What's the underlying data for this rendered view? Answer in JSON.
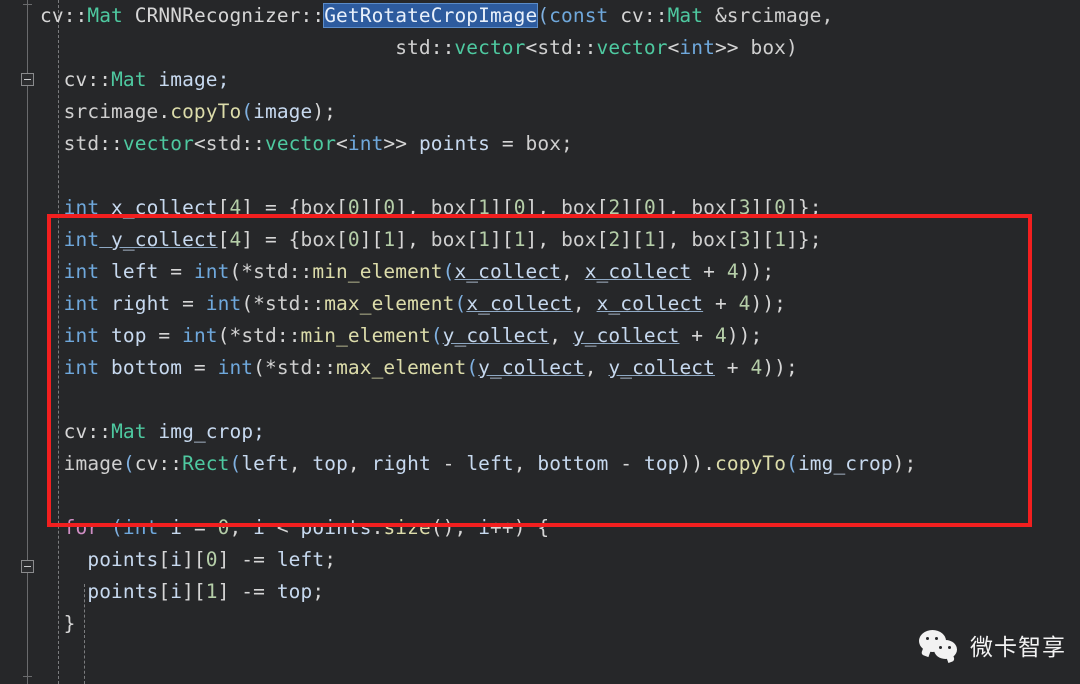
{
  "editor": {
    "theme_background": "#262729",
    "foreground": "#d6d6d6",
    "language": "C++",
    "font_size_px": 19.5,
    "line_height_px": 32,
    "gutter": {
      "fold_markers": [
        {
          "name": "fold-marker-function-body",
          "state": "expanded",
          "glyph": "minus-box"
        },
        {
          "name": "fold-marker-for-loop",
          "state": "expanded",
          "glyph": "minus-box"
        }
      ]
    },
    "selection": {
      "text": "GetRotateCropImage",
      "background": "#2d5b9e",
      "foreground": "#e8f0fb"
    },
    "annotation": {
      "shape": "rectangle",
      "color": "#f21f1f",
      "border_px": 4,
      "encloses_lines": [
        6,
        7,
        8,
        9,
        10,
        11,
        12,
        13,
        14
      ]
    }
  },
  "code": {
    "lines": [
      {
        "n": 1,
        "tokens": [
          {
            "t": "cv",
            "c": "plain"
          },
          {
            "t": "::",
            "c": "punc"
          },
          {
            "t": "Mat",
            "c": "cls"
          },
          {
            "t": " CRNNRecognizer",
            "c": "plain"
          },
          {
            "t": "::",
            "c": "punc"
          },
          {
            "t": "GetRotateCropImage",
            "c": "sel"
          },
          {
            "t": "(",
            "c": "paren"
          },
          {
            "t": "const",
            "c": "type"
          },
          {
            "t": " cv",
            "c": "plain"
          },
          {
            "t": "::",
            "c": "punc"
          },
          {
            "t": "Mat",
            "c": "cls"
          },
          {
            "t": " &srcimage,",
            "c": "dim"
          }
        ]
      },
      {
        "n": 2,
        "tokens": [
          {
            "t": "                              std",
            "c": "dim"
          },
          {
            "t": "::",
            "c": "punc"
          },
          {
            "t": "vector",
            "c": "cls"
          },
          {
            "t": "<",
            "c": "punc"
          },
          {
            "t": "std",
            "c": "dim"
          },
          {
            "t": "::",
            "c": "punc"
          },
          {
            "t": "vector",
            "c": "cls"
          },
          {
            "t": "<",
            "c": "punc"
          },
          {
            "t": "int",
            "c": "type"
          },
          {
            "t": ">> ",
            "c": "punc"
          },
          {
            "t": "box)",
            "c": "dim"
          }
        ]
      },
      {
        "n": 3,
        "tokens": [
          {
            "t": "  cv",
            "c": "plain"
          },
          {
            "t": "::",
            "c": "punc"
          },
          {
            "t": "Mat",
            "c": "cls"
          },
          {
            "t": " image;",
            "c": "var"
          }
        ]
      },
      {
        "n": 4,
        "tokens": [
          {
            "t": "  srcimage",
            "c": "dim"
          },
          {
            "t": ".",
            "c": "punc"
          },
          {
            "t": "copyTo",
            "c": "fn"
          },
          {
            "t": "(",
            "c": "paren"
          },
          {
            "t": "image",
            "c": "var"
          },
          {
            "t": ");",
            "c": "punc"
          }
        ]
      },
      {
        "n": 5,
        "tokens": [
          {
            "t": "  std",
            "c": "dim"
          },
          {
            "t": "::",
            "c": "punc"
          },
          {
            "t": "vector",
            "c": "cls"
          },
          {
            "t": "<",
            "c": "punc"
          },
          {
            "t": "std",
            "c": "dim"
          },
          {
            "t": "::",
            "c": "punc"
          },
          {
            "t": "vector",
            "c": "cls"
          },
          {
            "t": "<",
            "c": "punc"
          },
          {
            "t": "int",
            "c": "type"
          },
          {
            "t": ">> ",
            "c": "punc"
          },
          {
            "t": "points",
            "c": "var"
          },
          {
            "t": " = ",
            "c": "punc"
          },
          {
            "t": "box;",
            "c": "dim"
          }
        ]
      },
      {
        "n": 6,
        "tokens": []
      },
      {
        "n": 7,
        "tokens": [
          {
            "t": "  int",
            "c": "type"
          },
          {
            "t": " x_collect",
            "c": "occ"
          },
          {
            "t": "[",
            "c": "punc"
          },
          {
            "t": "4",
            "c": "num"
          },
          {
            "t": "] = {",
            "c": "punc"
          },
          {
            "t": "box",
            "c": "dim"
          },
          {
            "t": "[",
            "c": "punc"
          },
          {
            "t": "0",
            "c": "num"
          },
          {
            "t": "][",
            "c": "punc"
          },
          {
            "t": "0",
            "c": "num"
          },
          {
            "t": "], ",
            "c": "punc"
          },
          {
            "t": "box",
            "c": "dim"
          },
          {
            "t": "[",
            "c": "punc"
          },
          {
            "t": "1",
            "c": "num"
          },
          {
            "t": "][",
            "c": "punc"
          },
          {
            "t": "0",
            "c": "num"
          },
          {
            "t": "], ",
            "c": "punc"
          },
          {
            "t": "box",
            "c": "dim"
          },
          {
            "t": "[",
            "c": "punc"
          },
          {
            "t": "2",
            "c": "num"
          },
          {
            "t": "][",
            "c": "punc"
          },
          {
            "t": "0",
            "c": "num"
          },
          {
            "t": "], ",
            "c": "punc"
          },
          {
            "t": "box",
            "c": "dim"
          },
          {
            "t": "[",
            "c": "punc"
          },
          {
            "t": "3",
            "c": "num"
          },
          {
            "t": "][",
            "c": "punc"
          },
          {
            "t": "0",
            "c": "num"
          },
          {
            "t": "]};",
            "c": "punc"
          }
        ]
      },
      {
        "n": 8,
        "tokens": [
          {
            "t": "  int",
            "c": "type"
          },
          {
            "t": " y_collect",
            "c": "occ"
          },
          {
            "t": "[",
            "c": "punc"
          },
          {
            "t": "4",
            "c": "num"
          },
          {
            "t": "] = {",
            "c": "punc"
          },
          {
            "t": "box",
            "c": "dim"
          },
          {
            "t": "[",
            "c": "punc"
          },
          {
            "t": "0",
            "c": "num"
          },
          {
            "t": "][",
            "c": "punc"
          },
          {
            "t": "1",
            "c": "num"
          },
          {
            "t": "], ",
            "c": "punc"
          },
          {
            "t": "box",
            "c": "dim"
          },
          {
            "t": "[",
            "c": "punc"
          },
          {
            "t": "1",
            "c": "num"
          },
          {
            "t": "][",
            "c": "punc"
          },
          {
            "t": "1",
            "c": "num"
          },
          {
            "t": "], ",
            "c": "punc"
          },
          {
            "t": "box",
            "c": "dim"
          },
          {
            "t": "[",
            "c": "punc"
          },
          {
            "t": "2",
            "c": "num"
          },
          {
            "t": "][",
            "c": "punc"
          },
          {
            "t": "1",
            "c": "num"
          },
          {
            "t": "], ",
            "c": "punc"
          },
          {
            "t": "box",
            "c": "dim"
          },
          {
            "t": "[",
            "c": "punc"
          },
          {
            "t": "3",
            "c": "num"
          },
          {
            "t": "][",
            "c": "punc"
          },
          {
            "t": "1",
            "c": "num"
          },
          {
            "t": "]};",
            "c": "punc"
          }
        ]
      },
      {
        "n": 9,
        "tokens": [
          {
            "t": "  int",
            "c": "type"
          },
          {
            "t": " left",
            "c": "var"
          },
          {
            "t": " = ",
            "c": "punc"
          },
          {
            "t": "int",
            "c": "type"
          },
          {
            "t": "(*",
            "c": "punc"
          },
          {
            "t": "std",
            "c": "dim"
          },
          {
            "t": "::",
            "c": "punc"
          },
          {
            "t": "min_element",
            "c": "fn"
          },
          {
            "t": "(",
            "c": "paren"
          },
          {
            "t": "x_collect",
            "c": "occ"
          },
          {
            "t": ", ",
            "c": "punc"
          },
          {
            "t": "x_collect",
            "c": "occ"
          },
          {
            "t": " + ",
            "c": "punc"
          },
          {
            "t": "4",
            "c": "num"
          },
          {
            "t": "));",
            "c": "punc"
          }
        ]
      },
      {
        "n": 10,
        "tokens": [
          {
            "t": "  int",
            "c": "type"
          },
          {
            "t": " right",
            "c": "var"
          },
          {
            "t": " = ",
            "c": "punc"
          },
          {
            "t": "int",
            "c": "type"
          },
          {
            "t": "(*",
            "c": "punc"
          },
          {
            "t": "std",
            "c": "dim"
          },
          {
            "t": "::",
            "c": "punc"
          },
          {
            "t": "max_element",
            "c": "fn"
          },
          {
            "t": "(",
            "c": "paren"
          },
          {
            "t": "x_collect",
            "c": "occ"
          },
          {
            "t": ", ",
            "c": "punc"
          },
          {
            "t": "x_collect",
            "c": "occ"
          },
          {
            "t": " + ",
            "c": "punc"
          },
          {
            "t": "4",
            "c": "num"
          },
          {
            "t": "));",
            "c": "punc"
          }
        ]
      },
      {
        "n": 11,
        "tokens": [
          {
            "t": "  int",
            "c": "type"
          },
          {
            "t": " top",
            "c": "var"
          },
          {
            "t": " = ",
            "c": "punc"
          },
          {
            "t": "int",
            "c": "type"
          },
          {
            "t": "(*",
            "c": "punc"
          },
          {
            "t": "std",
            "c": "dim"
          },
          {
            "t": "::",
            "c": "punc"
          },
          {
            "t": "min_element",
            "c": "fn"
          },
          {
            "t": "(",
            "c": "paren"
          },
          {
            "t": "y_collect",
            "c": "occ"
          },
          {
            "t": ", ",
            "c": "punc"
          },
          {
            "t": "y_collect",
            "c": "occ"
          },
          {
            "t": " + ",
            "c": "punc"
          },
          {
            "t": "4",
            "c": "num"
          },
          {
            "t": "));",
            "c": "punc"
          }
        ]
      },
      {
        "n": 12,
        "tokens": [
          {
            "t": "  int",
            "c": "type"
          },
          {
            "t": " bottom",
            "c": "var"
          },
          {
            "t": " = ",
            "c": "punc"
          },
          {
            "t": "int",
            "c": "type"
          },
          {
            "t": "(*",
            "c": "punc"
          },
          {
            "t": "std",
            "c": "dim"
          },
          {
            "t": "::",
            "c": "punc"
          },
          {
            "t": "max_element",
            "c": "fn"
          },
          {
            "t": "(",
            "c": "paren"
          },
          {
            "t": "y_collect",
            "c": "occ"
          },
          {
            "t": ", ",
            "c": "punc"
          },
          {
            "t": "y_collect",
            "c": "occ"
          },
          {
            "t": " + ",
            "c": "punc"
          },
          {
            "t": "4",
            "c": "num"
          },
          {
            "t": "));",
            "c": "punc"
          }
        ]
      },
      {
        "n": 13,
        "tokens": []
      },
      {
        "n": 14,
        "tokens": [
          {
            "t": "  cv",
            "c": "plain"
          },
          {
            "t": "::",
            "c": "punc"
          },
          {
            "t": "Mat",
            "c": "cls"
          },
          {
            "t": " img_crop;",
            "c": "var"
          }
        ]
      },
      {
        "n": 15,
        "tokens": [
          {
            "t": "  image",
            "c": "dim"
          },
          {
            "t": "(",
            "c": "paren"
          },
          {
            "t": "cv",
            "c": "plain"
          },
          {
            "t": "::",
            "c": "punc"
          },
          {
            "t": "Rect",
            "c": "cls"
          },
          {
            "t": "(",
            "c": "paren"
          },
          {
            "t": "left",
            "c": "var"
          },
          {
            "t": ", ",
            "c": "punc"
          },
          {
            "t": "top",
            "c": "var"
          },
          {
            "t": ", ",
            "c": "punc"
          },
          {
            "t": "right",
            "c": "var"
          },
          {
            "t": " - ",
            "c": "punc"
          },
          {
            "t": "left",
            "c": "var"
          },
          {
            "t": ", ",
            "c": "punc"
          },
          {
            "t": "bottom",
            "c": "var"
          },
          {
            "t": " - ",
            "c": "punc"
          },
          {
            "t": "top",
            "c": "var"
          },
          {
            "t": "))",
            "c": "punc"
          },
          {
            "t": ".",
            "c": "punc"
          },
          {
            "t": "copyTo",
            "c": "fn"
          },
          {
            "t": "(",
            "c": "paren"
          },
          {
            "t": "img_crop",
            "c": "var"
          },
          {
            "t": ");",
            "c": "punc"
          }
        ]
      },
      {
        "n": 16,
        "tokens": []
      },
      {
        "n": 17,
        "tokens": [
          {
            "t": "  for",
            "c": "kw"
          },
          {
            "t": " (",
            "c": "paren"
          },
          {
            "t": "int",
            "c": "type"
          },
          {
            "t": " i",
            "c": "var"
          },
          {
            "t": " = ",
            "c": "punc"
          },
          {
            "t": "0",
            "c": "num"
          },
          {
            "t": "; ",
            "c": "punc"
          },
          {
            "t": "i",
            "c": "var"
          },
          {
            "t": " < ",
            "c": "punc"
          },
          {
            "t": "points",
            "c": "var"
          },
          {
            "t": ".",
            "c": "punc"
          },
          {
            "t": "size",
            "c": "fn"
          },
          {
            "t": "(); ",
            "c": "punc"
          },
          {
            "t": "i",
            "c": "var"
          },
          {
            "t": "++) {",
            "c": "punc"
          }
        ]
      },
      {
        "n": 18,
        "tokens": [
          {
            "t": "    points",
            "c": "var"
          },
          {
            "t": "[",
            "c": "punc"
          },
          {
            "t": "i",
            "c": "var"
          },
          {
            "t": "][",
            "c": "punc"
          },
          {
            "t": "0",
            "c": "num"
          },
          {
            "t": "] -= ",
            "c": "punc"
          },
          {
            "t": "left",
            "c": "var"
          },
          {
            "t": ";",
            "c": "punc"
          }
        ]
      },
      {
        "n": 19,
        "tokens": [
          {
            "t": "    points",
            "c": "var"
          },
          {
            "t": "[",
            "c": "punc"
          },
          {
            "t": "i",
            "c": "var"
          },
          {
            "t": "][",
            "c": "punc"
          },
          {
            "t": "1",
            "c": "num"
          },
          {
            "t": "] -= ",
            "c": "punc"
          },
          {
            "t": "top",
            "c": "var"
          },
          {
            "t": ";",
            "c": "punc"
          }
        ]
      },
      {
        "n": 20,
        "tokens": [
          {
            "t": "  }",
            "c": "punc"
          }
        ]
      }
    ]
  },
  "watermark": {
    "label": "微卡智享",
    "icon": "wechat-logo",
    "color": "#f2f2f2"
  }
}
